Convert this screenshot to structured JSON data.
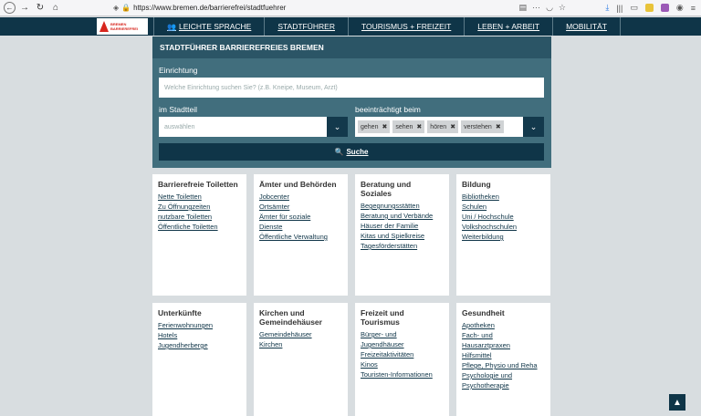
{
  "browser": {
    "url": "https://www.bremen.de/barrierefrei/stadtfuehrer"
  },
  "logo": {
    "line1": "BREMEN",
    "line2": "BARRIEREFREI"
  },
  "nav": {
    "items": [
      {
        "label": "LEICHTE SPRACHE"
      },
      {
        "label": "STADTFÜHRER"
      },
      {
        "label": "TOURISMUS + FREIZEIT"
      },
      {
        "label": "LEBEN + ARBEIT"
      },
      {
        "label": "MOBILITÄT"
      }
    ]
  },
  "search": {
    "title": "STADTFÜHRER BARRIEREFREIES BREMEN",
    "facility_label": "Einrichtung",
    "facility_placeholder": "Welche Einrichtung suchen Sie? (z.B. Kneipe, Museum, Arzt)",
    "district_label": "im Stadtteil",
    "district_value": "auswählen",
    "impaired_label": "beeinträchtigt beim",
    "tags": [
      "gehen",
      "sehen",
      "hören",
      "verstehen"
    ],
    "button_label": "Suche"
  },
  "cards": [
    {
      "title": "Barrierefreie Toiletten",
      "links": [
        "Nette Toiletten",
        "Zu Öffnungzeiten nutzbare Toiletten",
        "Öffentliche Toiletten"
      ]
    },
    {
      "title": "Ämter und Behörden",
      "links": [
        "Jobcenter",
        "Ortsämter",
        "Ämter für soziale Dienste",
        "Öffentliche Verwaltung"
      ]
    },
    {
      "title": "Beratung und Soziales",
      "links": [
        "Begegnungsstätten",
        "Beratung und Verbände",
        "Häuser der Familie",
        "Kitas und Spielkreise",
        "Tagesförderstätten"
      ]
    },
    {
      "title": "Bildung",
      "links": [
        "Bibliotheken",
        "Schulen",
        "Uni / Hochschule",
        "Volkshochschulen",
        "Weiterbildung"
      ]
    },
    {
      "title": "Unterkünfte",
      "links": [
        "Ferienwohnungen",
        "Hotels",
        "Jugendherberge"
      ]
    },
    {
      "title": "Kirchen und Gemeindehäuser",
      "links": [
        "Gemeindehäuser",
        "Kirchen"
      ]
    },
    {
      "title": "Freizeit und Tourismus",
      "links": [
        "Bürger- und Jugendhäuser",
        "Freizeitaktivitäten",
        "Kinos",
        "Touristen-Informationen"
      ]
    },
    {
      "title": "Gesundheit",
      "links": [
        "Apotheken",
        "Fach- und Hausarztpraxen",
        "Hilfsmittel",
        "Pflege, Physio und Reha",
        "Psychologie und Psychotherapie"
      ]
    }
  ]
}
